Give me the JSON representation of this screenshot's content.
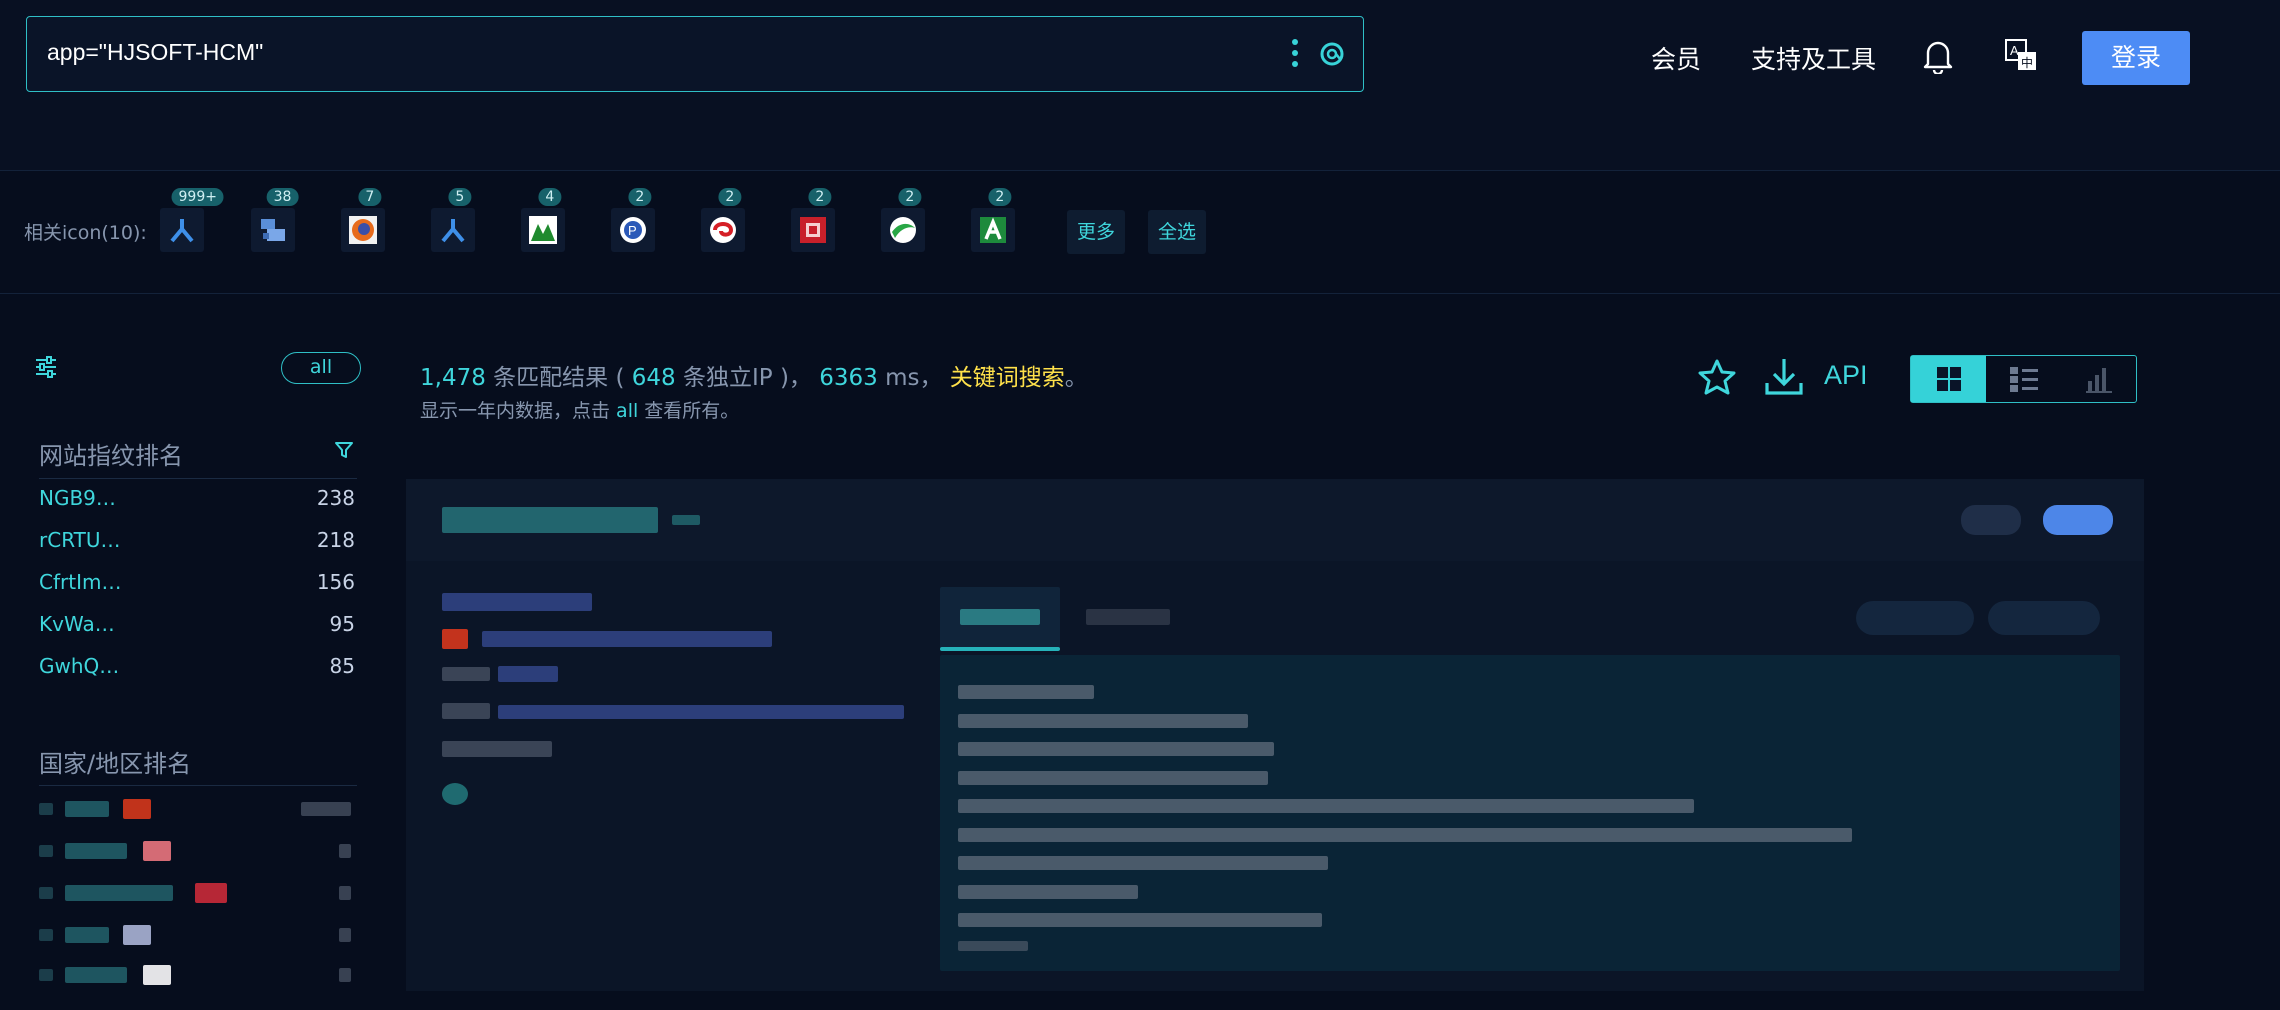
{
  "search": {
    "query": "app=\"HJSOFT-HCM\""
  },
  "nav": {
    "member": "会员",
    "support": "支持及工具",
    "login": "登录"
  },
  "icon_strip": {
    "label": "相关icon(10):",
    "icons": [
      {
        "name": "icon-1",
        "count": "999+"
      },
      {
        "name": "icon-2",
        "count": "38"
      },
      {
        "name": "icon-3",
        "count": "7"
      },
      {
        "name": "icon-4",
        "count": "5"
      },
      {
        "name": "icon-5",
        "count": "4"
      },
      {
        "name": "icon-6",
        "count": "2"
      },
      {
        "name": "icon-7",
        "count": "2"
      },
      {
        "name": "icon-8",
        "count": "2"
      },
      {
        "name": "icon-9",
        "count": "2"
      },
      {
        "name": "icon-10",
        "count": "2"
      }
    ],
    "more": "更多",
    "select_all": "全选"
  },
  "sidebar": {
    "all": "all",
    "fingerprint_title": "网站指纹排名",
    "fingerprints": [
      {
        "name": "NGB9…",
        "count": "238"
      },
      {
        "name": "rCRTU…",
        "count": "218"
      },
      {
        "name": "CfrtIm…",
        "count": "156"
      },
      {
        "name": "KvWa…",
        "count": "95"
      },
      {
        "name": "GwhQ…",
        "count": "85"
      }
    ],
    "country_title": "国家/地区排名"
  },
  "results": {
    "count": "1,478",
    "count_suffix": " 条匹配结果 ( ",
    "ip_count": "648",
    "ip_suffix": " 条独立IP )， ",
    "ms": "6363",
    "ms_suffix": " ms， ",
    "keyword": "关键词搜索",
    "period": "。",
    "sub_prefix": "显示一年内数据，点击 ",
    "sub_all": "all",
    "sub_suffix": " 查看所有。",
    "api": "API"
  },
  "colors": {
    "accent": "#3fd6dc",
    "login": "#4d8cf5",
    "keyword": "#ffe14a",
    "bg": "#060d1d"
  }
}
